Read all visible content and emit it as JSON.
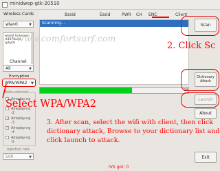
{
  "window": {
    "title": "minidwep-gtk-20510"
  },
  "left": {
    "wireless_cards_label": "Wireless Cards",
    "interface_value": "wlan0",
    "interface_info_line1": "wlan0 Unknown",
    "interface_info_line2": "rt3070usb - [phy0]",
    "channel_label": "Channel",
    "channel_value": "All",
    "encryption_label": "Encryption",
    "encryption_value": "WPA/WPA2",
    "mode_label": "Mode selected",
    "modes": [
      "Aireplay-ng -1",
      "Aireplay-ng -2",
      "Aireplay-ng -3",
      "Aireplay-ng -4",
      "Aireplay-ng -5"
    ],
    "modes_checked": [
      false,
      false,
      true,
      true,
      false
    ],
    "injection_rate_label": "Injection rate",
    "injection_rate_value": "500"
  },
  "table": {
    "columns": [
      "Bssid",
      "Essid",
      "PWR",
      "CH",
      "ENC",
      "Client"
    ],
    "active_column": "Client",
    "status_row": "Scanning..."
  },
  "progress": {
    "value_text": "24",
    "fraction": 0.62
  },
  "buttons": {
    "scan": "Scan",
    "dictionary_attack_line1": "Dictionary",
    "dictionary_attack_line2": "Attack",
    "launch": "Launch",
    "about": "About",
    "exit": "Exit"
  },
  "status_bar": {
    "ivs": "IVS got: 0"
  },
  "overlay": {
    "step2": "2. Click Sc",
    "select_enc": "Select WPA/WPA2",
    "step3": "3. After scan, select the wifi with client, then click dictionary attack, Browse to your dictionary list and click launch to attack.",
    "watermark": "www.comfortsurf.com"
  },
  "colors": {
    "annotation": "#ff0000",
    "progress": "#00d21c",
    "selection": "#2f6fbe"
  }
}
